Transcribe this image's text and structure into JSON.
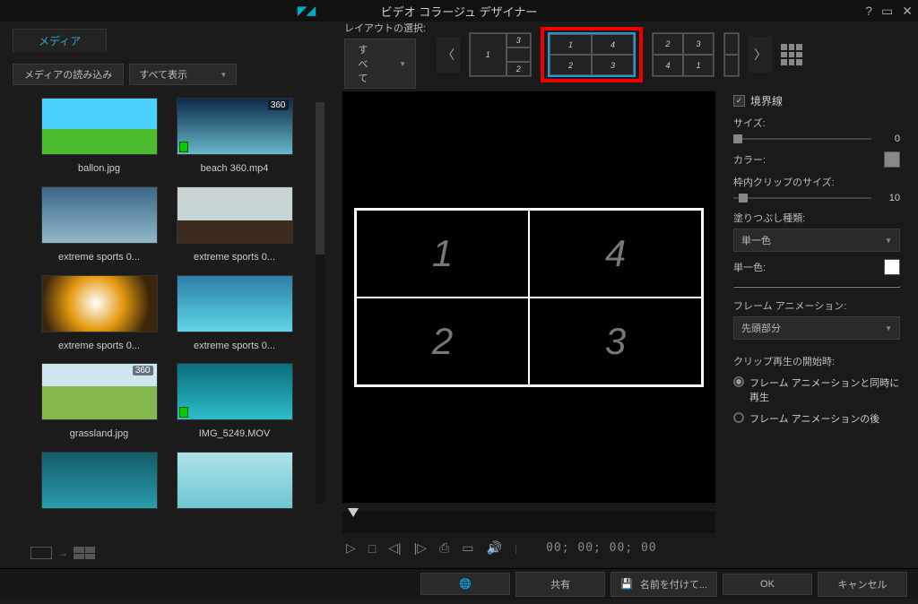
{
  "title": "ビデオ コラージュ デザイナー",
  "tabs": {
    "media": "メディア"
  },
  "left": {
    "import": "メディアの読み込み",
    "filter": "すべて表示",
    "items": [
      {
        "name": "ballon.jpg",
        "badge": ""
      },
      {
        "name": "beach 360.mp4",
        "badge": "360",
        "video": true
      },
      {
        "name": "extreme sports 0...",
        "badge": ""
      },
      {
        "name": "extreme sports 0...",
        "badge": ""
      },
      {
        "name": "extreme sports 0...",
        "badge": ""
      },
      {
        "name": "extreme sports 0...",
        "badge": ""
      },
      {
        "name": "grassland.jpg",
        "badge": "360"
      },
      {
        "name": "IMG_5249.MOV",
        "badge": "",
        "video": true
      }
    ]
  },
  "layout": {
    "label": "レイアウトの選択:",
    "all": "すべて"
  },
  "preview_cells": [
    "1",
    "4",
    "2",
    "3"
  ],
  "timecode": "00; 00; 00; 00",
  "props": {
    "border": "境界線",
    "size": "サイズ:",
    "size_val": "0",
    "color": "カラー:",
    "interclip": "枠内クリップのサイズ:",
    "interclip_val": "10",
    "fill_type": "塗りつぶし種類:",
    "fill_solid": "単一色",
    "solid_color": "単一色:",
    "frame_anim": "フレーム アニメーション:",
    "frame_anim_val": "先頭部分",
    "clip_start": "クリップ再生の開始時:",
    "radio1": "フレーム アニメーションと同時に再生",
    "radio2": "フレーム アニメーションの後"
  },
  "bottom": {
    "share": "共有",
    "saveas": "名前を付けて...",
    "ok": "OK",
    "cancel": "キャンセル"
  }
}
